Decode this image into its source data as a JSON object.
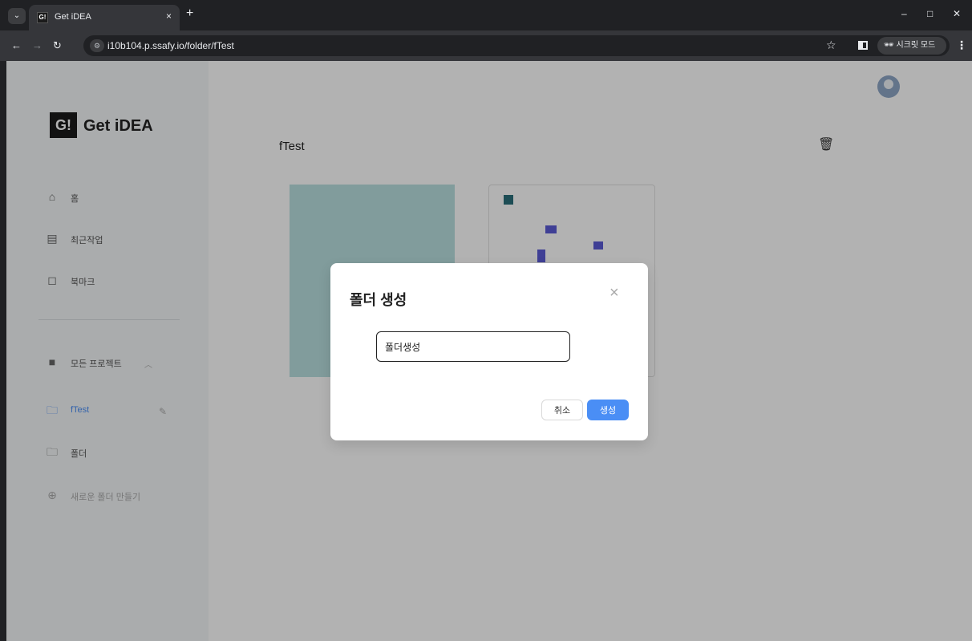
{
  "browser": {
    "tab_title": "Get iDEA",
    "tab_close": "×",
    "new_tab": "+",
    "url": "i10b104.p.ssafy.io/folder/fTest",
    "incognito_label": "시크릿 모드",
    "minimize": "–",
    "maximize": "□",
    "close": "✕",
    "favicon_text": "G!"
  },
  "sidebar": {
    "logo_mark": "G!",
    "logo_text": "Get iDEA",
    "items": [
      {
        "icon": "home-icon",
        "label": "홈"
      },
      {
        "icon": "recent-icon",
        "label": "최근작업"
      },
      {
        "icon": "bookmark-icon",
        "label": "북마크"
      },
      {
        "icon": "project-icon",
        "label": "모든 프로젝트"
      },
      {
        "icon": "folder-icon",
        "label": "fTest"
      },
      {
        "icon": "folder-icon",
        "label": "폴더"
      },
      {
        "icon": "add-folder-icon",
        "label": "새로운 폴더 만들기"
      }
    ]
  },
  "main": {
    "folder_title": "fTest"
  },
  "modal": {
    "title": "폴더 생성",
    "close": "×",
    "input_value": "폴더생성",
    "cancel_label": "취소",
    "create_label": "생성"
  },
  "colors": {
    "accent": "#4a8ef5",
    "card1": "#b9e0e0"
  }
}
